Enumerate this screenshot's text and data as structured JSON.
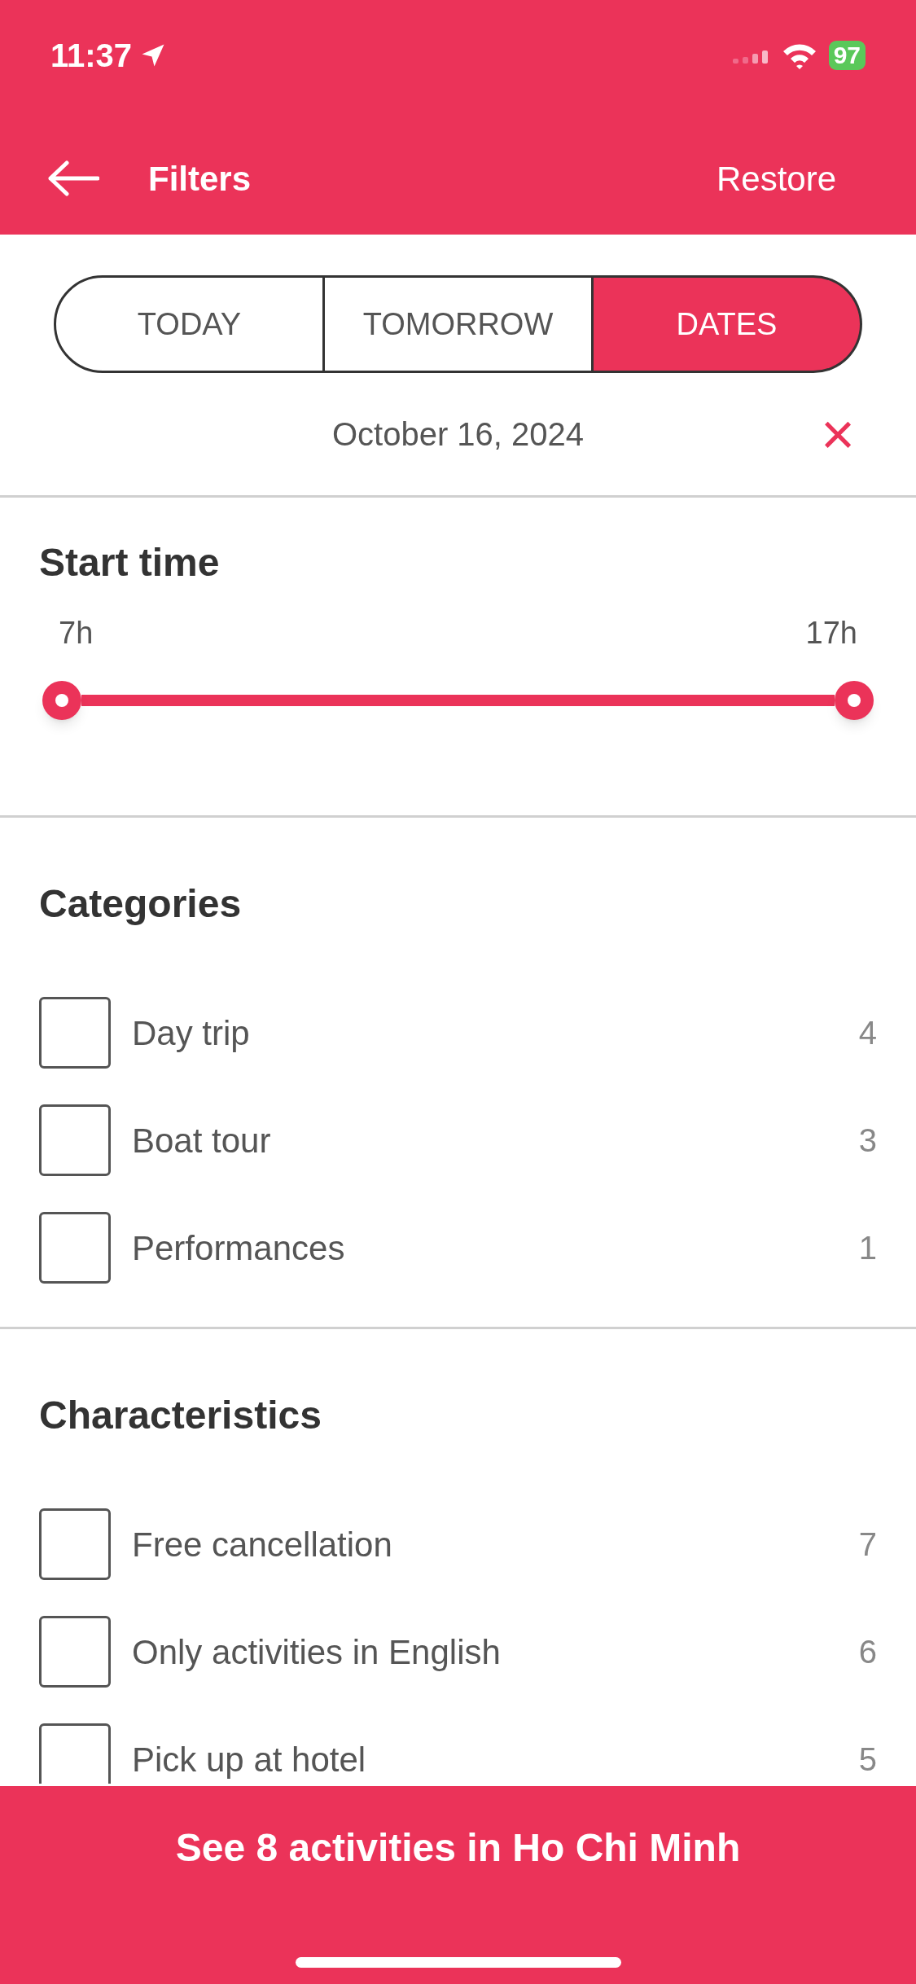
{
  "status_bar": {
    "time": "11:37",
    "battery": "97"
  },
  "nav": {
    "title": "Filters",
    "action": "Restore"
  },
  "tabs": [
    {
      "label": "TODAY",
      "selected": false
    },
    {
      "label": "TOMORROW",
      "selected": false
    },
    {
      "label": "DATES",
      "selected": true
    }
  ],
  "date": {
    "value": "October 16, 2024",
    "clear": "×"
  },
  "start_time": {
    "title": "Start time",
    "min_label": "7h",
    "max_label": "17h",
    "level": 1
  },
  "categories": {
    "title": "Categories",
    "items": [
      {
        "label": "Day trip",
        "count": "4",
        "checked": false
      },
      {
        "label": "Boat tour",
        "count": "3",
        "checked": false
      },
      {
        "label": "Performances",
        "count": "1",
        "checked": false
      }
    ]
  },
  "characteristics": {
    "title": "Characteristics",
    "items": [
      {
        "label": "Free cancellation",
        "count": "7",
        "checked": false
      },
      {
        "label": "Only activities in English",
        "count": "6",
        "checked": false
      },
      {
        "label": "Pick up at hotel",
        "count": "5",
        "checked": false
      }
    ]
  },
  "footer": {
    "button": "See 8 activities in Ho Chi Minh"
  }
}
